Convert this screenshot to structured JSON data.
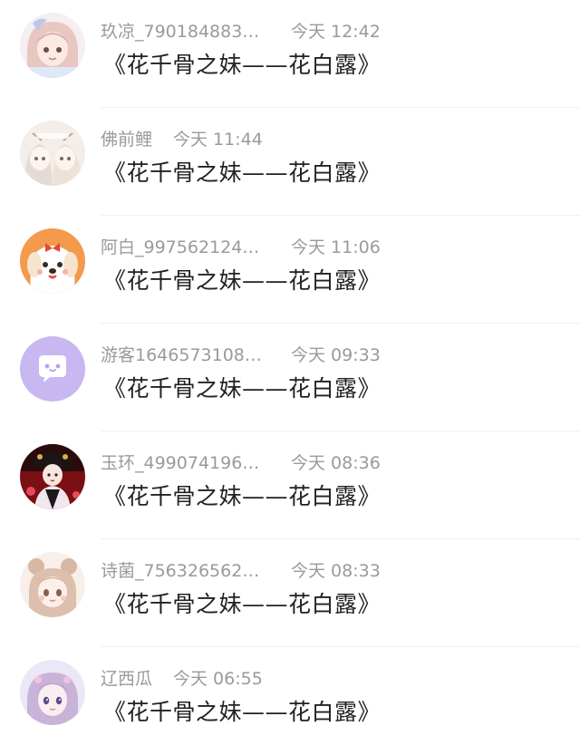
{
  "messages": [
    {
      "user": "玖凉_790184883…",
      "time": "今天 12:42",
      "text": "《花千骨之妹——花白露》",
      "avatar": "anime-girl-pink-avatar"
    },
    {
      "user": "佛前鲤",
      "time": "今天 11:44",
      "text": "《花千骨之妹——花白露》",
      "avatar": "anime-sketch-pair-avatar"
    },
    {
      "user": "阿白_997562124…",
      "time": "今天 11:06",
      "text": "《花千骨之妹——花白露》",
      "avatar": "cartoon-dog-orange-avatar"
    },
    {
      "user": "游客1646573108…",
      "time": "今天 09:33",
      "text": "《花千骨之妹——花白露》",
      "avatar": "guest-chat-bubble-avatar"
    },
    {
      "user": "玉环_499074196…",
      "time": "今天 08:36",
      "text": "《花千骨之妹——花白露》",
      "avatar": "ancient-costume-avatar"
    },
    {
      "user": "诗菌_756326562…",
      "time": "今天 08:33",
      "text": "《花千骨之妹——花白露》",
      "avatar": "anime-girl-bun-avatar"
    },
    {
      "user": "辽西瓜",
      "time": "今天 06:55",
      "text": "《花千骨之妹——花白露》",
      "avatar": "anime-girl-purple-avatar"
    }
  ],
  "colors": {
    "meta_text": "#9a9a9a",
    "title_text": "#222222",
    "guest_avatar_bg": "#c9b7f2",
    "dog_avatar_bg": "#f39a4d",
    "divider": "#f0f0f0"
  }
}
